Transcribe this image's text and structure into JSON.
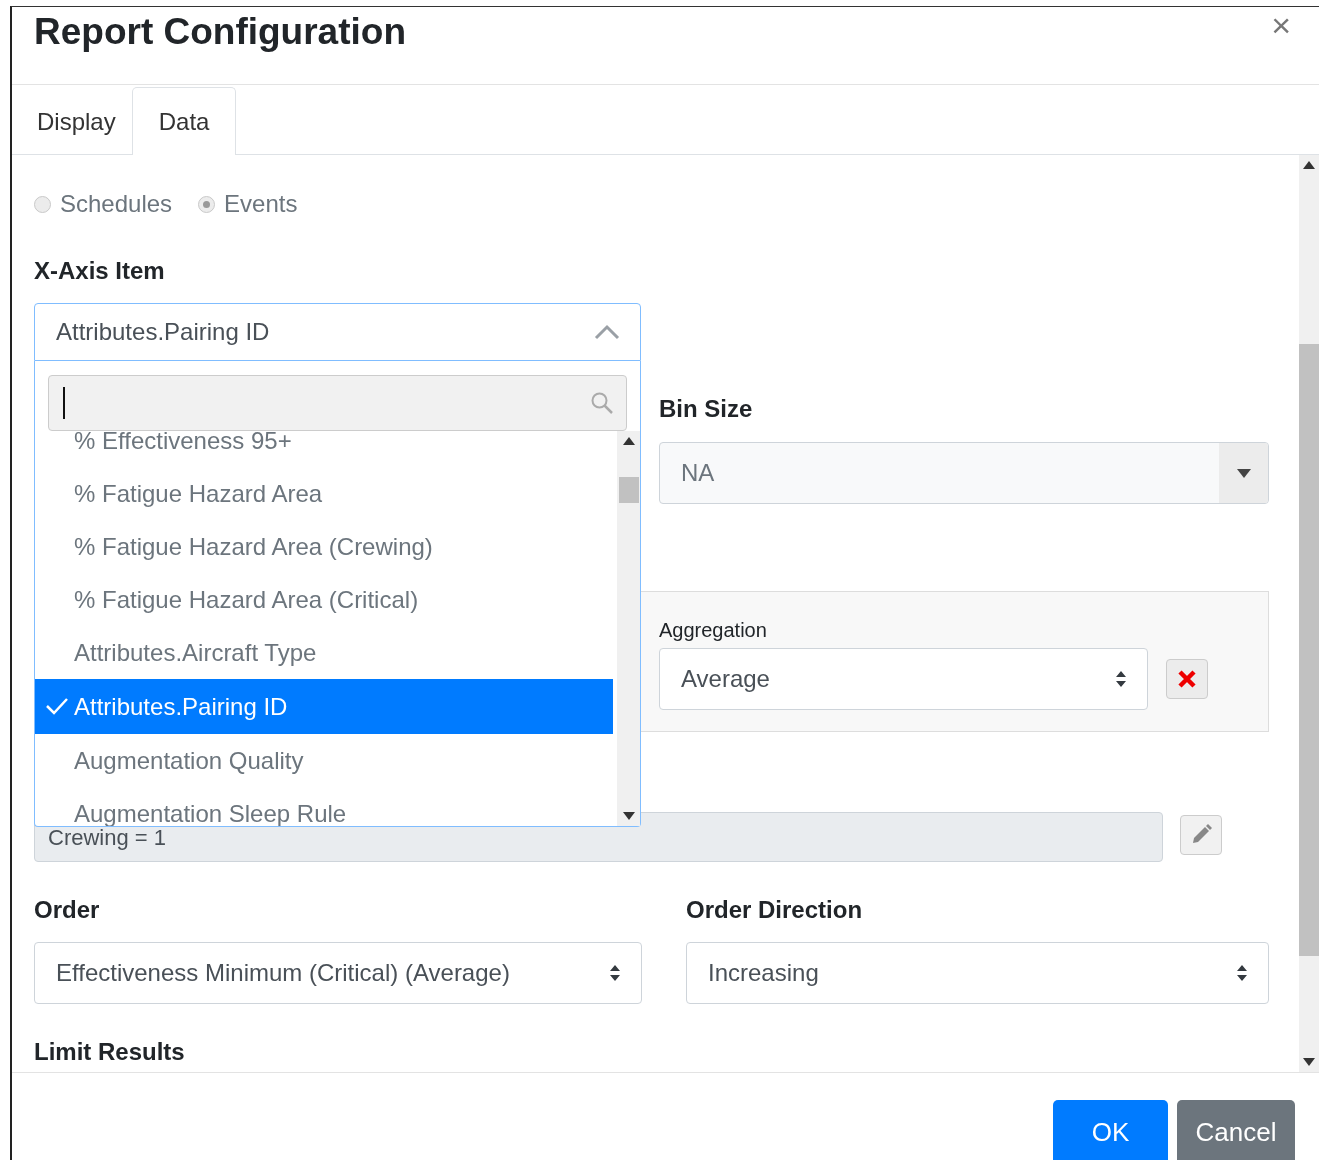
{
  "dialog": {
    "title": "Report Configuration",
    "close": "×"
  },
  "tabs": [
    {
      "label": "Display",
      "selected": false
    },
    {
      "label": "Data",
      "selected": true
    }
  ],
  "data_type": {
    "disabled": true,
    "options": [
      {
        "label": "Schedules",
        "selected": false
      },
      {
        "label": "Events",
        "selected": true
      }
    ]
  },
  "x_axis": {
    "label": "X-Axis Item",
    "value": "Attributes.Pairing ID",
    "expanded": true,
    "options": [
      {
        "label": "% Effectiveness 95+",
        "selected": false
      },
      {
        "label": "% Fatigue Hazard Area",
        "selected": false
      },
      {
        "label": "% Fatigue Hazard Area (Crewing)",
        "selected": false
      },
      {
        "label": "% Fatigue Hazard Area (Critical)",
        "selected": false
      },
      {
        "label": "Attributes.Aircraft Type",
        "selected": false
      },
      {
        "label": "Attributes.Pairing ID",
        "selected": true
      },
      {
        "label": "Augmentation Quality",
        "selected": false
      },
      {
        "label": "Augmentation Sleep Rule",
        "selected": false
      }
    ]
  },
  "bin_size": {
    "label": "Bin Size",
    "value": "NA",
    "disabled": true
  },
  "aggregation": {
    "label": "Aggregation",
    "value": "Average"
  },
  "filter": {
    "value": "Crewing = 1"
  },
  "order": {
    "label": "Order",
    "value": "Effectiveness Minimum (Critical) (Average)"
  },
  "order_direction": {
    "label": "Order Direction",
    "value": "Increasing"
  },
  "limit_results": {
    "label": "Limit Results"
  },
  "buttons": [
    {
      "label": "OK",
      "kind": "primary"
    },
    {
      "label": "Cancel",
      "kind": "secondary"
    }
  ]
}
